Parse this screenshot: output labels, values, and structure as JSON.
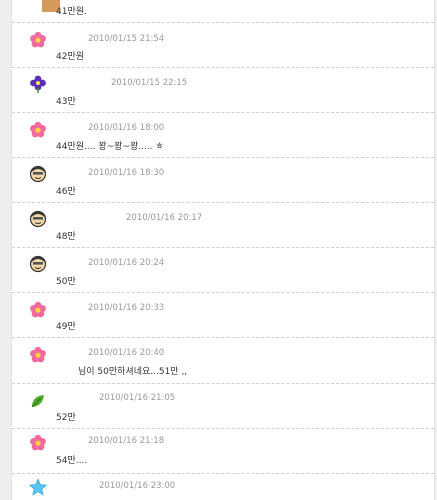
{
  "comments": [
    {
      "text": "41만원.",
      "time": "",
      "avatar": "partial-avatar-icon"
    },
    {
      "text": "42만원",
      "time": "2010/01/15 21:54",
      "avatar": "pink-flower-icon"
    },
    {
      "text": "43만",
      "time": "2010/01/15 22:15",
      "avatar": "purple-flower-icon"
    },
    {
      "text": "44만원.... 꽝~꽝~꽝..... ㅎ",
      "time": "2010/01/16 18:00",
      "avatar": "pink-flower-icon"
    },
    {
      "text": "46만",
      "time": "2010/01/16 18:30",
      "avatar": "cartoon-face-icon"
    },
    {
      "text": "48만",
      "time": "2010/01/16 20:17",
      "avatar": "cartoon-face-icon"
    },
    {
      "text": "50만",
      "time": "2010/01/16 20:24",
      "avatar": "cartoon-face-icon"
    },
    {
      "text": "49만",
      "time": "2010/01/16 20:33",
      "avatar": "pink-flower-icon"
    },
    {
      "text": "님이 50만하셔네요...51만 ,,",
      "time": "2010/01/16 20:40",
      "avatar": "pink-flower-icon"
    },
    {
      "text": "52만",
      "time": "2010/01/16 21:05",
      "avatar": "green-leaf-icon"
    },
    {
      "text": "54만....",
      "time": "2010/01/16 21:18",
      "avatar": "pink-flower-icon"
    },
    {
      "text": "",
      "time": "2010/01/16 23:00",
      "avatar": "blue-star-icon"
    }
  ]
}
